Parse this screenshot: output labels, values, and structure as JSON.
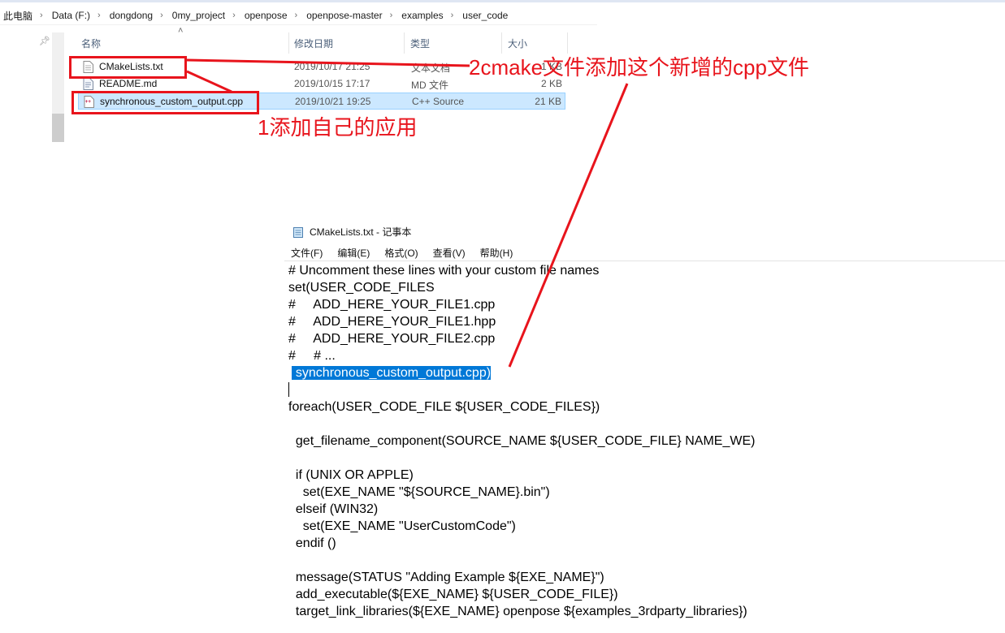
{
  "breadcrumb": [
    "此电脑",
    "Data (F:)",
    "dongdong",
    "0my_project",
    "openpose",
    "openpose-master",
    "examples",
    "user_code"
  ],
  "file_list": {
    "columns": {
      "name": "名称",
      "date": "修改日期",
      "type": "类型",
      "size": "大小"
    },
    "rows": [
      {
        "name": "CMakeLists.txt",
        "date": "2019/10/17 21:25",
        "type": "文本文档",
        "size": "1 KB",
        "icon": "text-file-icon"
      },
      {
        "name": "README.md",
        "date": "2019/10/15 17:17",
        "type": "MD 文件",
        "size": "2 KB",
        "icon": "md-file-icon"
      },
      {
        "name": "synchronous_custom_output.cpp",
        "date": "2019/10/21 19:25",
        "type": "C++ Source",
        "size": "21 KB",
        "icon": "cpp-file-icon",
        "selected": true
      }
    ]
  },
  "annotations": {
    "note1": "1添加自己的应用",
    "note2": "2cmake文件添加这个新增的cpp文件",
    "color": "#e8141c"
  },
  "notepad": {
    "title": "CMakeLists.txt - 记事本",
    "menu": [
      "文件(F)",
      "编辑(E)",
      "格式(O)",
      "查看(V)",
      "帮助(H)"
    ],
    "lines": [
      "# Uncomment these lines with your custom file names",
      "set(USER_CODE_FILES",
      "#     ADD_HERE_YOUR_FILE1.cpp",
      "#     ADD_HERE_YOUR_FILE1.hpp",
      "#     ADD_HERE_YOUR_FILE2.cpp",
      "#     # ...",
      "",
      "",
      "foreach(USER_CODE_FILE ${USER_CODE_FILES})",
      "",
      "  get_filename_component(SOURCE_NAME ${USER_CODE_FILE} NAME_WE)",
      "",
      "  if (UNIX OR APPLE)",
      "    set(EXE_NAME \"${SOURCE_NAME}.bin\")",
      "  elseif (WIN32)",
      "    set(EXE_NAME \"UserCustomCode\")",
      "  endif ()",
      "",
      "  message(STATUS \"Adding Example ${EXE_NAME}\")",
      "  add_executable(${EXE_NAME} ${USER_CODE_FILE})",
      "  target_link_libraries(${EXE_NAME} openpose ${examples_3rdparty_libraries})"
    ],
    "selected_line_prefix": " ",
    "selected_line_text": " synchronous_custom_output.cpp)"
  }
}
